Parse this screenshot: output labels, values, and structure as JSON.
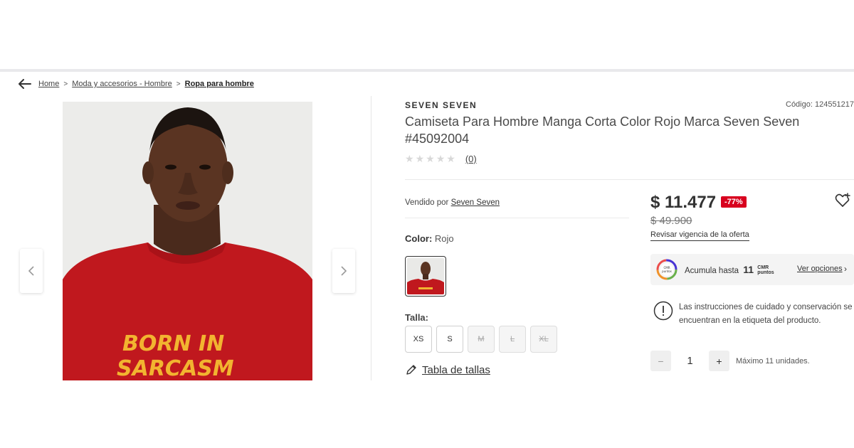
{
  "breadcrumb": {
    "items": [
      "Home",
      "Moda y accesorios - Hombre",
      "Ropa para hombre"
    ],
    "separator": ">"
  },
  "product": {
    "brand": "SEVEN SEVEN",
    "code": "Código: 124551217",
    "title": "Camiseta Para Hombre Manga Corta Color Rojo Marca Seven Seven #45092004",
    "rating": {
      "stars": 0,
      "max": 5,
      "reviews": "(0)"
    },
    "image_text": {
      "line1": "BORN IN",
      "line2": "SARCASM"
    },
    "sold_by": {
      "label": "Vendido por",
      "seller": "Seven Seven"
    },
    "color": {
      "label": "Color:",
      "value": "Rojo"
    },
    "size": {
      "label": "Talla:",
      "options": [
        {
          "label": "XS",
          "available": true
        },
        {
          "label": "S",
          "available": true
        },
        {
          "label": "M",
          "available": false
        },
        {
          "label": "L",
          "available": false
        },
        {
          "label": "XL",
          "available": false
        }
      ],
      "table_link": "Tabla de tallas"
    }
  },
  "pricing": {
    "price": "$ 11.477",
    "discount": "-77%",
    "old_price": "$ 49.900",
    "offer_link": "Revisar vigencia de la oferta"
  },
  "points": {
    "text": "Acumula hasta",
    "amount": "11",
    "suffix_top": "CMR",
    "suffix_bottom": "puntos",
    "options_link": "Ver opciones"
  },
  "care": {
    "text": "Las instrucciones de cuidado y conservación se encuentran en la etiqueta del producto."
  },
  "quantity": {
    "minus": "−",
    "value": "1",
    "plus": "+",
    "max_text": "Máximo 11 unidades."
  },
  "colors": {
    "shirt_red": "#c0181e",
    "print_yellow": "#f2b430",
    "discount_bg": "#d8001e",
    "image_bg": "#ececea"
  }
}
